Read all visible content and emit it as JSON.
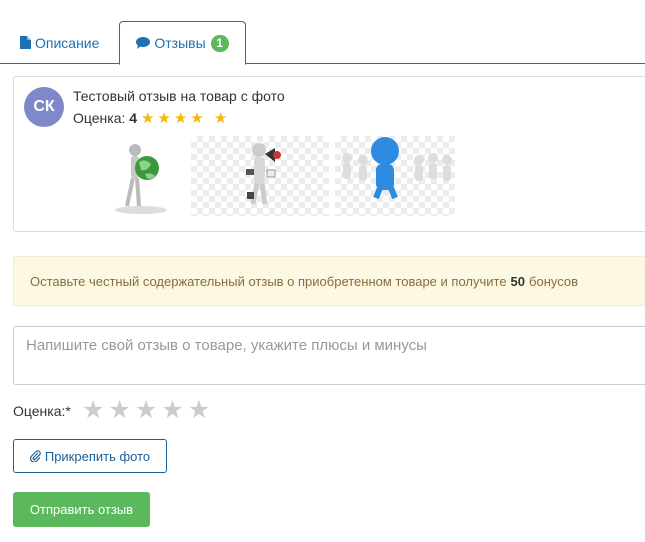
{
  "tabs": {
    "description": {
      "label": "Описание",
      "icon": "document-icon"
    },
    "reviews": {
      "label": "Отзывы",
      "icon": "comment-icon",
      "count": "1"
    }
  },
  "review": {
    "initials": "СК",
    "text": "Тестовый отзыв на товар с фото",
    "rating_label": "Оценка:",
    "rating_value": "4",
    "stars": "★★★★ ★",
    "photos": [
      "globe-figure-photo",
      "megaphone-figure-photo",
      "leader-figure-photo"
    ]
  },
  "notice": {
    "before": "Оставьте честный содержательный отзыв о приобретенном товаре и получите",
    "bonus": "50",
    "after": "бонусов"
  },
  "form": {
    "placeholder": "Напишите свой отзыв о товаре, укажите плюсы и минусы",
    "rating_label": "Оценка:*",
    "attach_label": "Прикрепить фото",
    "attach_icon": "paperclip-icon",
    "submit_label": "Отправить отзыв"
  },
  "colors": {
    "accent": "#1f6fb2",
    "success": "#5cb85c",
    "star": "#f5b50a",
    "avatar": "#7f89c9"
  }
}
